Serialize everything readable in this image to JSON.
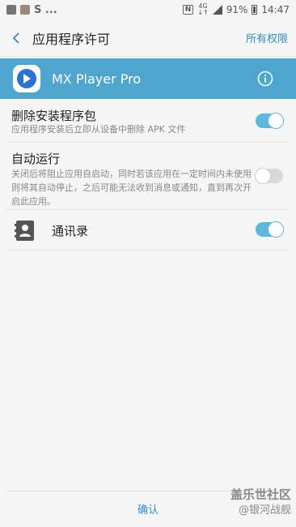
{
  "status_bar": {
    "notification_text": "S ...",
    "network_label": "4G",
    "network_sub": "↓↑",
    "battery": "91%",
    "time": "14:47"
  },
  "header": {
    "title": "应用程序许可",
    "all_permissions": "所有权限"
  },
  "app": {
    "name": "MX Player Pro"
  },
  "permissions": [
    {
      "title": "删除安装程序包",
      "description": "应用程序安装后立即从设备中删除 APK 文件",
      "enabled": true
    },
    {
      "title": "自动运行",
      "description": "关闭后将阻止应用自启动，同时若该应用在一定时间内未使用则将其自动停止，之后可能无法收到消息或通知，直到再次开启此应用。",
      "enabled": false
    },
    {
      "title": "通讯录",
      "icon": "contacts-icon",
      "enabled": true
    }
  ],
  "footer": {
    "confirm": "确认"
  },
  "watermark": {
    "line1": "盖乐世社区",
    "line2": "@银河战舰"
  },
  "colors": {
    "accent": "#2f8fc6",
    "app_bar": "#4ea6cf",
    "toggle_on": "#5cb8dd",
    "toggle_off": "#d9d9d9"
  }
}
